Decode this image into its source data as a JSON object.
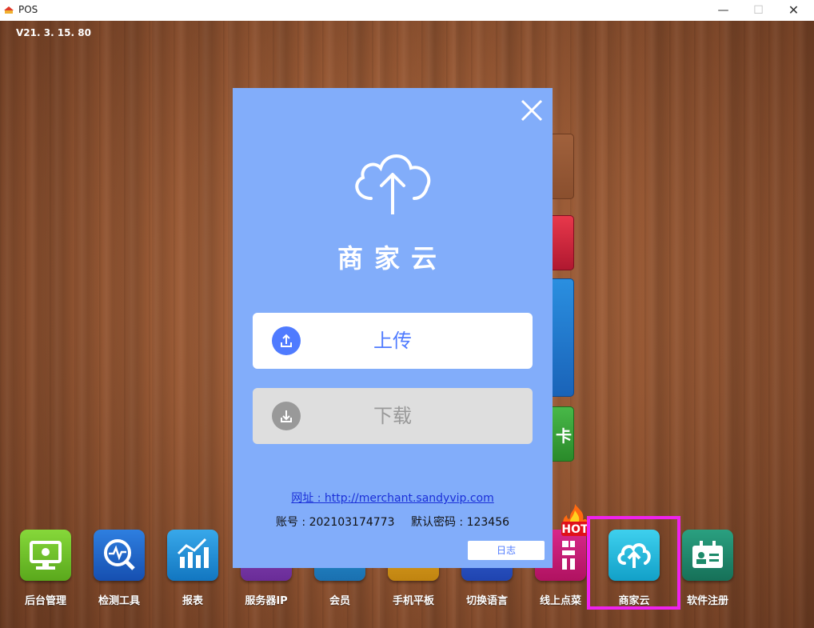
{
  "window": {
    "title": "POS",
    "min_icon": "minimize-icon",
    "max_icon": "maximize-icon",
    "close_icon": "close-icon"
  },
  "version": "V21. 3. 15. 80",
  "dialog": {
    "title": "商家云",
    "icon": "cloud-upload-icon",
    "upload_label": "上传",
    "download_label": "下载",
    "website": "网址 : http://merchant.sandyvip.com",
    "account_label": "账号 : 202103174773",
    "password_label": "默认密码 : 123456",
    "log_label": "日志"
  },
  "dock": [
    {
      "label": "后台管理",
      "icon": "monitor-gear-icon",
      "color": "#6cc02a"
    },
    {
      "label": "检测工具",
      "icon": "search-pulse-icon",
      "color": "#1e64c8"
    },
    {
      "label": "报表",
      "icon": "bar-chart-icon",
      "color": "#1f8fd6"
    },
    {
      "label": "服务器IP",
      "icon": "server-icon",
      "color": "#7b3fa8"
    },
    {
      "label": "会员",
      "icon": "member-icon",
      "color": "#1e88c8"
    },
    {
      "label": "手机平板",
      "icon": "tablet-icon",
      "color": "#d99a18"
    },
    {
      "label": "切换语言",
      "icon": "language-icon",
      "color": "#2a55c8"
    },
    {
      "label": "线上点菜",
      "icon": "qr-code-icon",
      "color": "#c81a6e",
      "badge": "HOT"
    },
    {
      "label": "商家云",
      "icon": "cloud-upload-icon",
      "color": "#19b6d8"
    },
    {
      "label": "软件注册",
      "icon": "id-card-icon",
      "color": "#1d8a6a"
    }
  ],
  "side_tile_text": "卡"
}
